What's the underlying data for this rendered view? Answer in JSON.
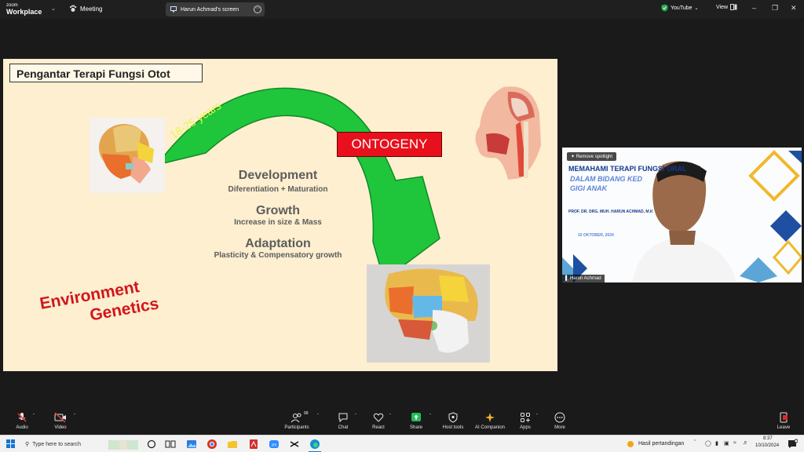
{
  "app": {
    "logo_line1": "zoom",
    "logo_line2": "Workplace",
    "meeting_label": "Meeting",
    "share_label": "Harun Achmad's screen",
    "youtube_label": "YouTube",
    "view_label": "View"
  },
  "slide": {
    "title": "Pengantar Terapi Fungsi Otot",
    "arc_label": "18-25 years",
    "ontogeny": "ONTOGENY",
    "stages": [
      {
        "heading": "Development",
        "sub": "Diferentiation + Maturation"
      },
      {
        "heading": "Growth",
        "sub": "Increase in size & Mass"
      },
      {
        "heading": "Adaptation",
        "sub": "Plasticity & Compensatory growth"
      }
    ],
    "factors": [
      "Environment",
      "Genetics"
    ]
  },
  "video": {
    "spotlight_btn": "Remove spotlight",
    "title": "MEMAHAMI TERAPI FUNGSI ORAL",
    "sub1": "DALAM BIDANG KED",
    "sub2": "GIGI ANAK",
    "prof": "PROF. DR. DRG. MUH. HARUN ACHMAD, M.K",
    "date": "10 OKTOBER, 2024",
    "participant_name": "Harun Achmad"
  },
  "toolbar": {
    "audio": "Audio",
    "video": "Video",
    "participants": "Participants",
    "participants_count": "99",
    "chat": "Chat",
    "react": "React",
    "share": "Share",
    "host_tools": "Host tools",
    "ai_companion": "AI Companion",
    "apps": "Apps",
    "more": "More",
    "leave": "Leave"
  },
  "taskbar": {
    "search_placeholder": "Type here to search",
    "news": "Hasil pertandingan",
    "time": "8:37",
    "date": "10/10/2024"
  },
  "colors": {
    "slide_bg": "#fdefcf",
    "arrow_green": "#1fc63b",
    "ontogeny_red": "#e8101c",
    "factor_red": "#d2161e",
    "share_green": "#1fbf56",
    "leave_red": "#e02828"
  }
}
